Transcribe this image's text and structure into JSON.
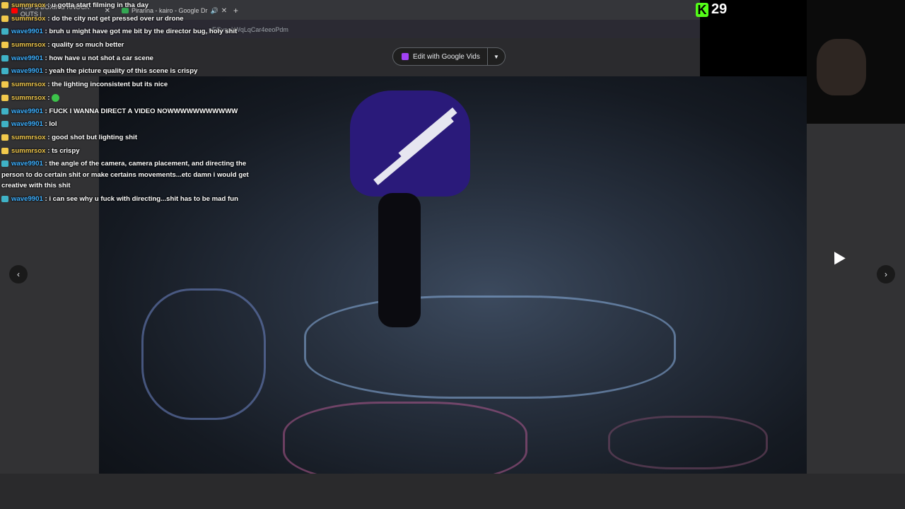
{
  "browser": {
    "tabs": [
      {
        "label": "TOP 5 BOXING KNOCK OUTS |",
        "favicon_color": "#ff0000"
      },
      {
        "label": "Piranna - kairo - Google Dr",
        "favicon_color": "#34a853"
      }
    ],
    "url": "_nEGvsoLWqLqCar4eeoPdm"
  },
  "drive": {
    "edit_button_label": "Edit with Google Vids",
    "prev_icon": "chevron-left-icon",
    "next_icon": "chevron-right-icon"
  },
  "stream": {
    "viewer_count": "29",
    "brand_color": "#53fc18"
  },
  "chat": [
    {
      "user": "summrsox",
      "text": ": u gotta start filming in tha day"
    },
    {
      "user": "summrsox",
      "text": ": do the city not get pressed over ur drone"
    },
    {
      "user": "wave9901",
      "text": ": bruh u might have got me bit by the director bug, holy shit"
    },
    {
      "user": "summrsox",
      "text": ": quality so much better"
    },
    {
      "user": "wave9901",
      "text": ": how have u not shot a car scene"
    },
    {
      "user": "wave9901",
      "text": ": yeah the picture quality of this scene is crispy"
    },
    {
      "user": "summrsox",
      "text": ": the lighting inconsistent but its nice"
    },
    {
      "user": "summrsox",
      "text": ":"
    },
    {
      "user": "wave9901",
      "text": ": FUCK I WANNA DIRECT A VIDEO NOWWWWWWWWWWW"
    },
    {
      "user": "wave9901",
      "text": ": lol"
    },
    {
      "user": "summrsox",
      "text": ": good shot but lighting shit"
    },
    {
      "user": "summrsox",
      "text": ": ts crispy"
    },
    {
      "user": "wave9901",
      "text": ": the angle of the camera, camera placement, and directing the person to do certain shit or make certains movements...etc damn i would get creative with this shit"
    },
    {
      "user": "wave9901",
      "text": ": i can see why u fuck with directing...shit has to be mad fun"
    }
  ]
}
